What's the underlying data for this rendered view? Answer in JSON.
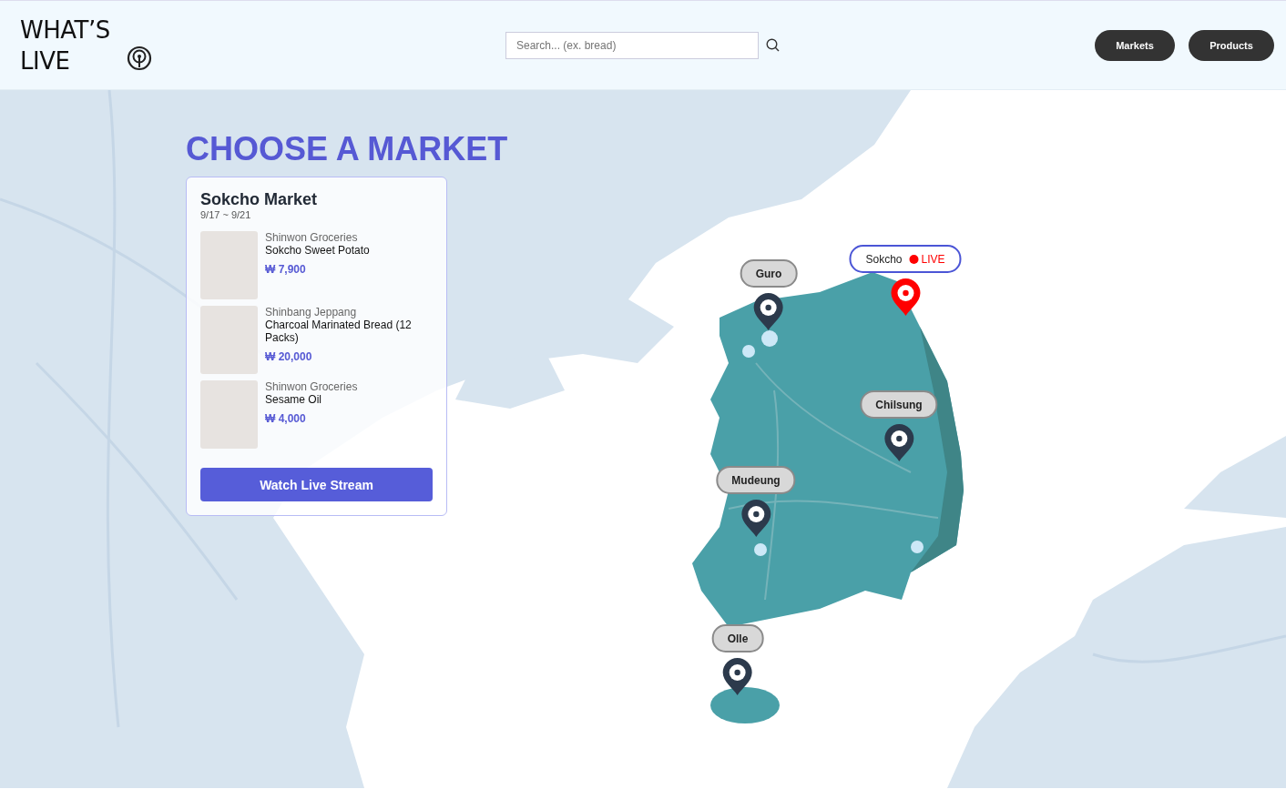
{
  "header": {
    "logo_lines": [
      "WHAT’S",
      "LIVE"
    ],
    "search": {
      "placeholder": "Search... (ex. bread)"
    },
    "nav_buttons": [
      "Markets",
      "Products"
    ]
  },
  "page_title": "CHOOSE A MARKET",
  "market_card": {
    "title": "Sokcho Market",
    "dates": "9/17 ~ 9/21",
    "products": [
      {
        "store": "Shinwon Groceries",
        "name": "Sokcho Sweet Potato",
        "price": "₩ 7,900"
      },
      {
        "store": "Shinbang Jeppang",
        "name": "Charcoal Marinated Bread (12 Packs)",
        "price": "₩ 20,000"
      },
      {
        "store": "Shinwon Groceries",
        "name": "Sesame Oil",
        "price": "₩ 4,000"
      }
    ],
    "button": "Watch Live Stream"
  },
  "markers": [
    {
      "label": "Guro",
      "live": false
    },
    {
      "label": "Sokcho",
      "live": true,
      "badge": "LIVE"
    },
    {
      "label": "Chilsung",
      "live": false
    },
    {
      "label": "Mudeung",
      "live": false
    },
    {
      "label": "Olle",
      "live": false
    }
  ]
}
